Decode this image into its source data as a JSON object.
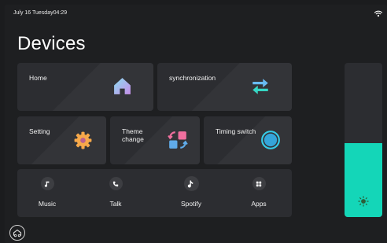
{
  "status": {
    "datetime": "July 16 Tuesday04:29",
    "wifi_icon": "wifi-icon"
  },
  "title": "Devices",
  "tiles": {
    "home": {
      "label": "Home",
      "icon": "house-icon",
      "color": "#7fd3e8"
    },
    "sync": {
      "label": "synchronization",
      "icon": "sync-arrows-icon",
      "color": "#5fb7f0"
    },
    "setting": {
      "label": "Setting",
      "icon": "gear-icon",
      "color": "#f5a142"
    },
    "theme": {
      "label": "Theme\nchange",
      "icon": "theme-change-icon",
      "color": "#5aa8e8"
    },
    "timing": {
      "label": "Timing switch",
      "icon": "timer-ring-icon",
      "color": "#2fc7e4"
    }
  },
  "media": [
    {
      "label": "Music",
      "icon": "music-note-icon"
    },
    {
      "label": "Talk",
      "icon": "phone-icon"
    },
    {
      "label": "Spotify",
      "icon": "spotify-note-icon"
    },
    {
      "label": "Apps",
      "icon": "apps-grid-icon"
    }
  ],
  "brightness": {
    "level": 0.48,
    "fill_color": "#14d6b8",
    "icon": "sun-icon"
  },
  "bottom_nav": {
    "icon": "car-home-icon"
  }
}
